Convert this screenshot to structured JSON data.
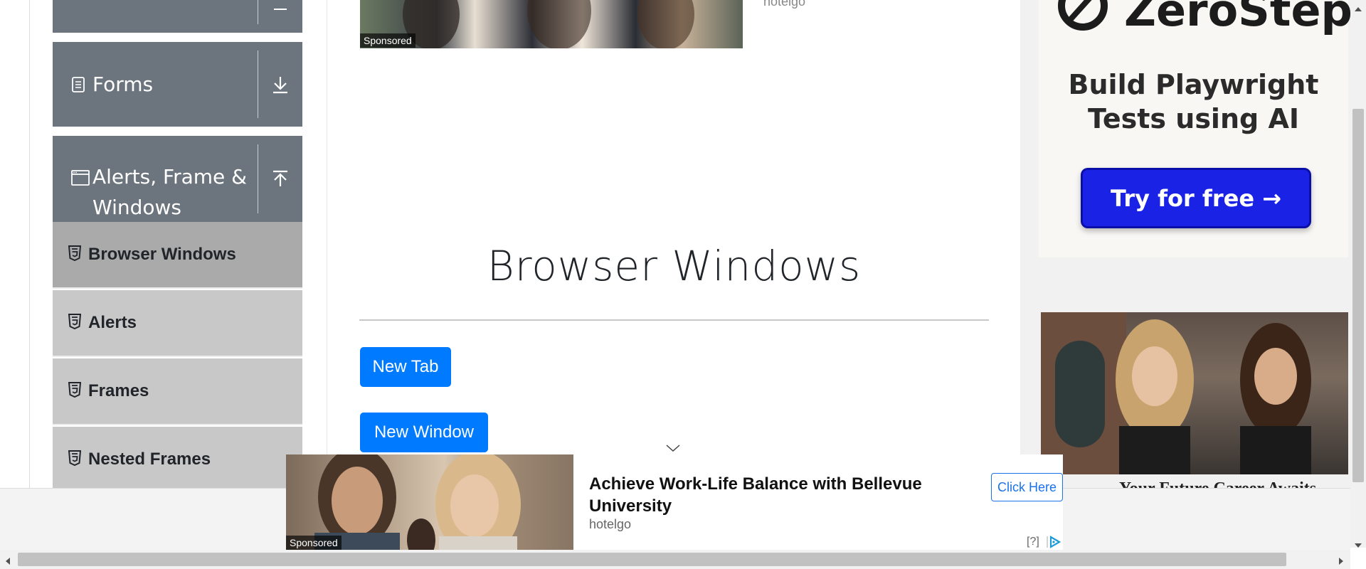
{
  "sidebar": {
    "groups": [
      {
        "title": "Forms",
        "icon": "document-icon",
        "toggle_icon": "download-arrow-icon"
      },
      {
        "title_line1": "Alerts, Frame &",
        "title_line2": "Windows",
        "icon": "window-icon",
        "toggle_icon": "upload-arrow-icon"
      }
    ],
    "items": [
      {
        "label": "Browser Windows",
        "active": true
      },
      {
        "label": "Alerts",
        "active": false
      },
      {
        "label": "Frames",
        "active": false
      },
      {
        "label": "Nested Frames",
        "active": false
      }
    ]
  },
  "top_ad": {
    "sponsored": "Sponsored",
    "advertiser": "hotelgo"
  },
  "main": {
    "title": "Browser Windows",
    "buttons": {
      "new_tab": "New Tab",
      "new_window": "New Window"
    }
  },
  "right_ad": {
    "brand": "ZeroStep",
    "tagline_line1": "Build Playwright",
    "tagline_line2": "Tests using AI",
    "cta": "Try for free →",
    "caption_partial": "Your Future Career Awaits"
  },
  "bottom_banner": {
    "sponsored": "Sponsored",
    "title": "Achieve Work-Life Balance with Bellevue University",
    "advertiser": "hotelgo",
    "cta": "Click Here",
    "info": "[?]"
  },
  "colors": {
    "sidebar_group": "#6c757d",
    "sidebar_item": "#c8c8c8",
    "sidebar_item_active": "#aaaaaa",
    "primary_button": "#007bff",
    "zerostep_cta": "#1a22e6"
  }
}
